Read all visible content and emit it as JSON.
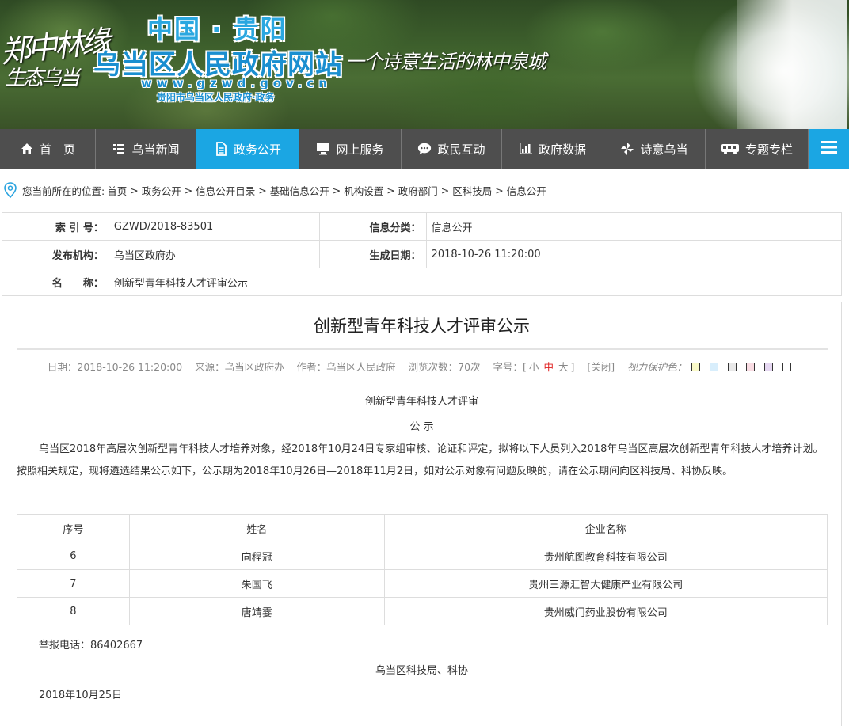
{
  "banner": {
    "brush_left": "郑中林缘",
    "brush_left2": "生态乌当",
    "top_title": "中国 · 贵阳",
    "site_name": "乌当区人民政府网站",
    "url": "www.gzwd.gov.cn",
    "sub": "贵阳市乌当区人民政府·政务",
    "slogan": "一个诗意生活的林中泉城"
  },
  "nav": {
    "items": [
      {
        "label": "首　页",
        "icon": "home-icon"
      },
      {
        "label": "乌当新闻",
        "icon": "list-icon"
      },
      {
        "label": "政务公开",
        "icon": "document-icon"
      },
      {
        "label": "网上服务",
        "icon": "monitor-icon"
      },
      {
        "label": "政民互动",
        "icon": "chat-icon"
      },
      {
        "label": "政府数据",
        "icon": "bar-chart-icon"
      },
      {
        "label": "诗意乌当",
        "icon": "pinwheel-icon"
      },
      {
        "label": "专题专栏",
        "icon": "bus-icon"
      }
    ],
    "active_index": 2,
    "menu_icon": "menu-icon"
  },
  "breadcrumb": {
    "prefix": "您当前所在的位置:",
    "items": [
      "首页",
      "政务公开",
      "信息公开目录",
      "基础信息公开",
      "机构设置",
      "政府部门",
      "区科技局",
      "信息公开"
    ],
    "separator": ">"
  },
  "info": {
    "index_label": "索 引 号：",
    "index_value": "GZWD/2018-83501",
    "category_label": "信息分类：",
    "category_value": "信息公开",
    "publisher_label": "发布机构：",
    "publisher_value": "乌当区政府办",
    "date_label": "生成日期：",
    "date_value": "2018-10-26 11:20:00",
    "name_label": "名　　称：",
    "name_value": "创新型青年科技人才评审公示"
  },
  "article": {
    "title": "创新型青年科技人才评审公示",
    "meta": {
      "date": "日期：2018-10-26 11:20:00",
      "source": "来源：乌当区政府办",
      "author": "作者：乌当区人民政府",
      "views": "浏览次数：70次",
      "font_label": "字号：[",
      "font_small": "小",
      "font_mid": "中",
      "font_large": "大",
      "font_close": "]",
      "close": "[关闭]",
      "eye_label": "视力保护色：",
      "swatches": [
        "#fafac8",
        "#d8eefc",
        "#e8e8e8",
        "#f9dce3",
        "#e6d8f2",
        "#ffffff"
      ]
    },
    "heading1": "创新型青年科技人才评审",
    "heading2": "公  示",
    "body": "乌当区2018年高层次创新型青年科技人才培养对象，经2018年10月24日专家组审核、论证和评定，拟将以下人员列入2018年乌当区高层次创新型青年科技人才培养计划。按照相关规定，现将遴选结果公示如下，公示期为2018年10月26日—2018年11月2日，如对公示对象有问题反映的，请在公示期间向区科技局、科协反映。",
    "table": {
      "headers": [
        "序号",
        "姓名",
        "企业名称"
      ],
      "rows": [
        [
          "6",
          "向程冠",
          "贵州航图教育科技有限公司"
        ],
        [
          "7",
          "朱国飞",
          "贵州三源汇智大健康产业有限公司"
        ],
        [
          "8",
          "唐靖霎",
          "贵州威门药业股份有限公司"
        ]
      ]
    },
    "hotline": "举报电话：86402667",
    "signature": "乌当区科技局、科协",
    "sign_date": "2018年10月25日"
  }
}
